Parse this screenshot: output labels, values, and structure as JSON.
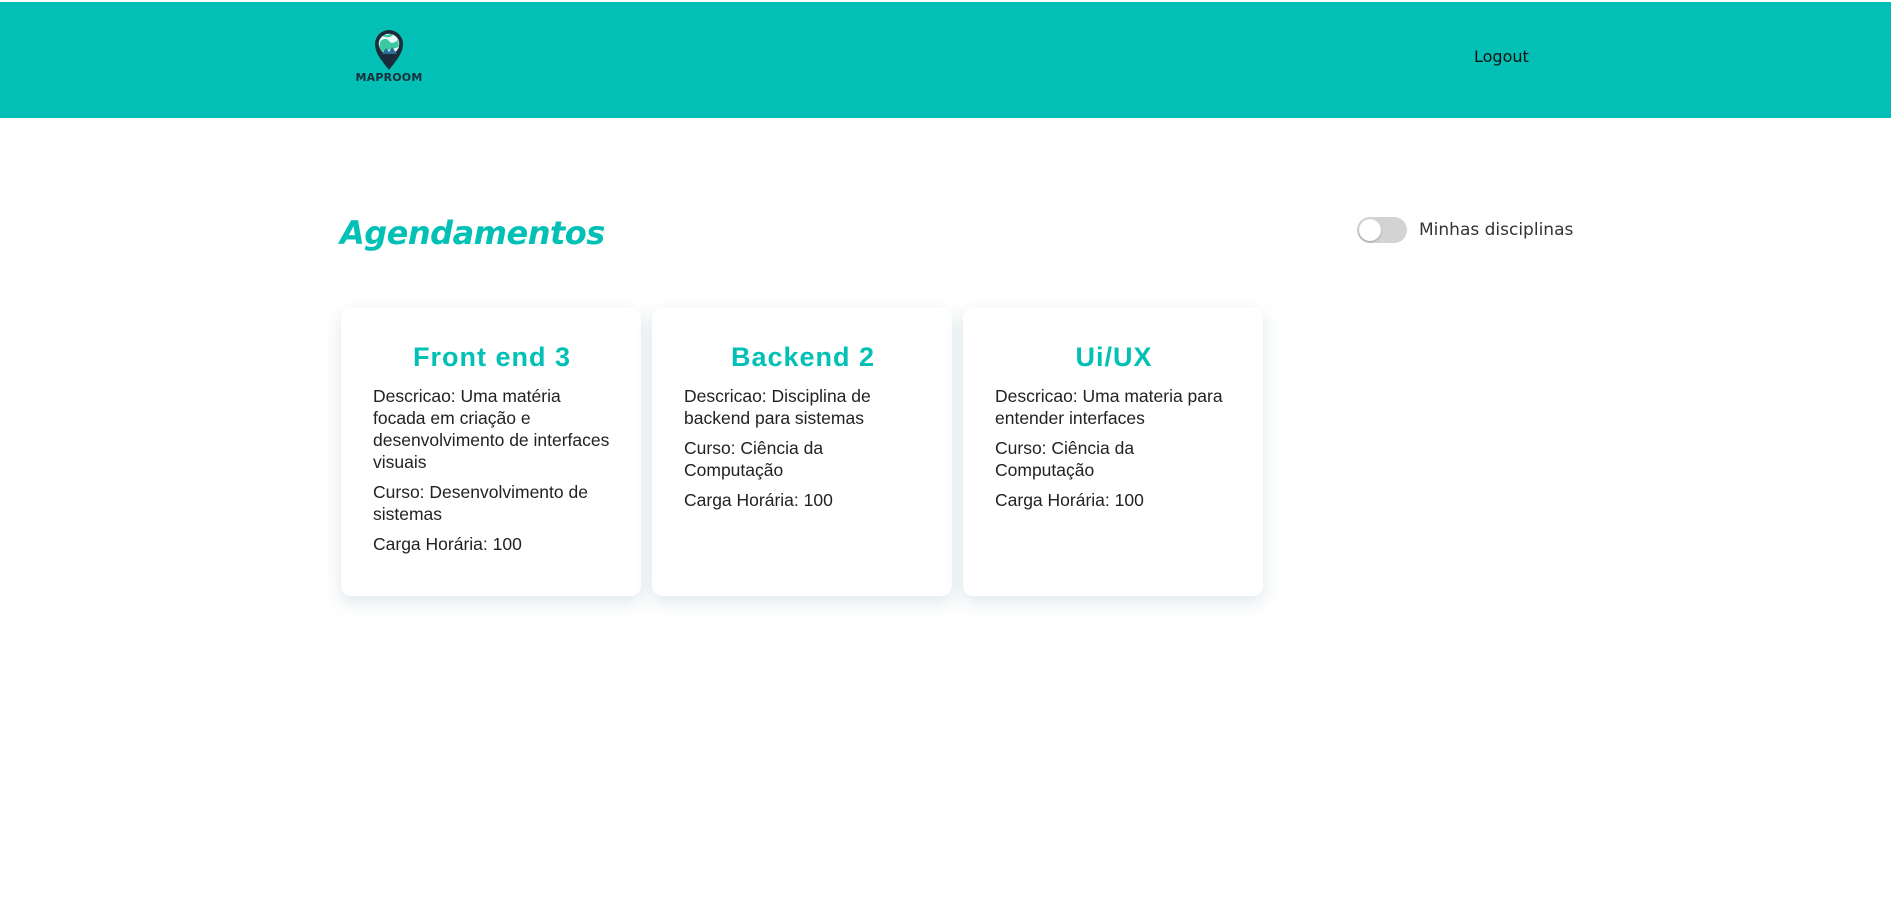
{
  "header": {
    "brand": "MAPROOM",
    "logout_label": "Logout",
    "background_color": "#02c0b5"
  },
  "main": {
    "title": "Agendamentos",
    "filter_toggle": {
      "label": "Minhas disciplinas",
      "checked": false
    },
    "cards": [
      {
        "title": "Front end 3",
        "descricao": "Descricao: Uma matéria focada em criação e desenvolvimento de interfaces visuais",
        "curso": "Curso: Desenvolvimento de sistemas",
        "carga": "Carga Horária: 100"
      },
      {
        "title": "Backend 2",
        "descricao": "Descricao: Disciplina de backend para sistemas",
        "curso": "Curso: Ciência da Computação",
        "carga": "Carga Horária: 100"
      },
      {
        "title": "Ui/UX",
        "descricao": "Descricao: Uma materia para entender interfaces",
        "curso": "Curso: Ciência da Computação",
        "carga": "Carga Horária: 100"
      }
    ]
  },
  "icons": {
    "logo": "map-pin-globe-icon"
  },
  "colors": {
    "accent": "#02c0b5",
    "text": "#222222",
    "toggle_off": "#d3d3d3"
  }
}
